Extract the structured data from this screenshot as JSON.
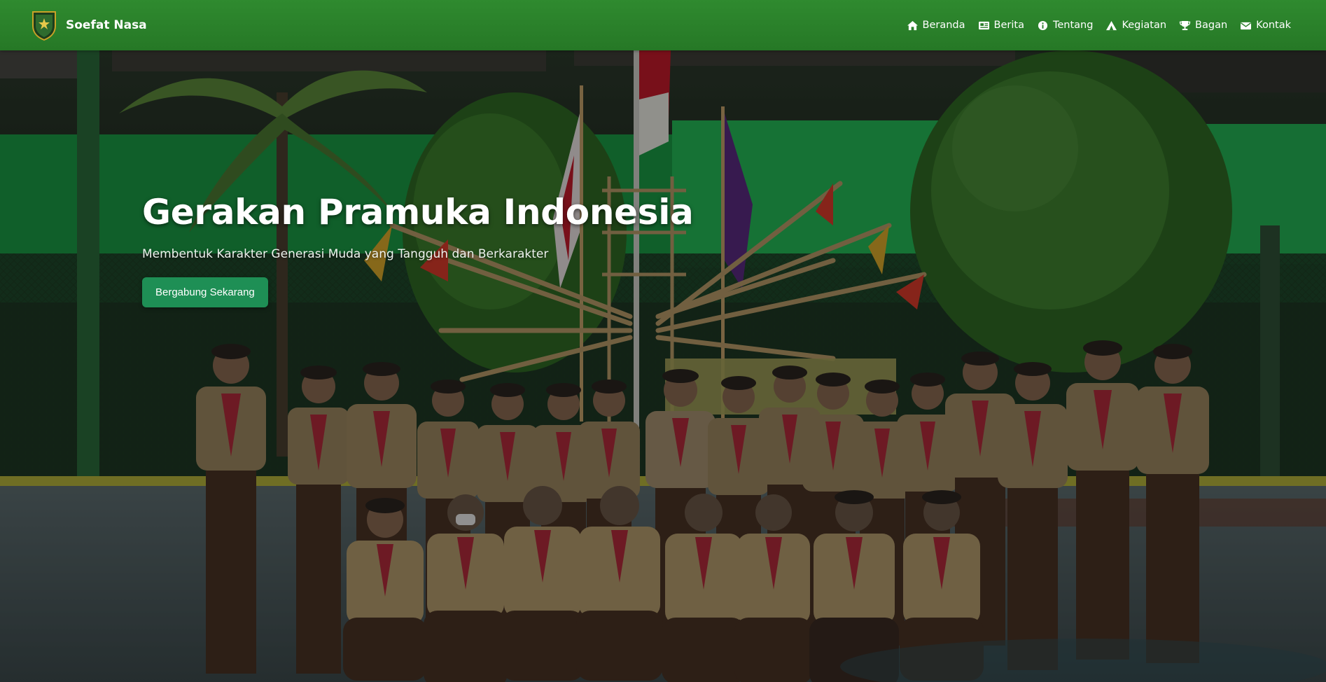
{
  "brand": {
    "name": "Soefat Nasa",
    "logo_icon": "scout-shield-icon"
  },
  "nav": {
    "items": [
      {
        "label": "Beranda",
        "icon": "home-icon"
      },
      {
        "label": "Berita",
        "icon": "newspaper-icon"
      },
      {
        "label": "Tentang",
        "icon": "info-circle-icon"
      },
      {
        "label": "Kegiatan",
        "icon": "campfire-icon"
      },
      {
        "label": "Bagan",
        "icon": "trophy-icon"
      },
      {
        "label": "Kontak",
        "icon": "envelope-icon"
      }
    ]
  },
  "hero": {
    "title": "Gerakan Pramuka Indonesia",
    "subtitle": "Membentuk Karakter Generasi Muda yang Tangguh dan Berkarakter",
    "cta_label": "Bergabung Sekarang",
    "background": "group-photo-of-scouts"
  },
  "colors": {
    "navbar": "#2f8a2f",
    "cta": "#1e8f55",
    "text": "#ffffff"
  }
}
